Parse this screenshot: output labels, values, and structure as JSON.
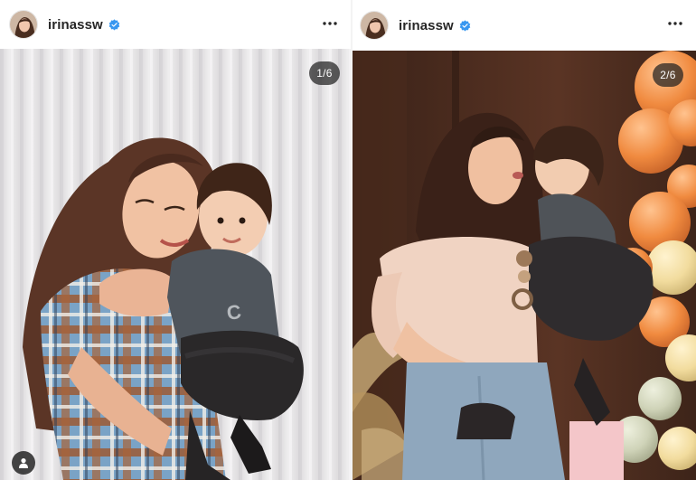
{
  "posts": [
    {
      "username": "irinassw",
      "verified": true,
      "icons": {
        "avatar": "profile-avatar",
        "verified": "verified-badge-icon",
        "menu": "more-options-icon",
        "tag": "tagged-user-icon"
      },
      "carousel_counter": "1/6"
    },
    {
      "username": "irinassw",
      "verified": true,
      "icons": {
        "avatar": "profile-avatar",
        "verified": "verified-badge-icon",
        "menu": "more-options-icon"
      },
      "carousel_counter": "2/6"
    }
  ],
  "colors": {
    "verified_blue": "#3897f0",
    "text": "#262626",
    "counter_bg": "#202020"
  }
}
